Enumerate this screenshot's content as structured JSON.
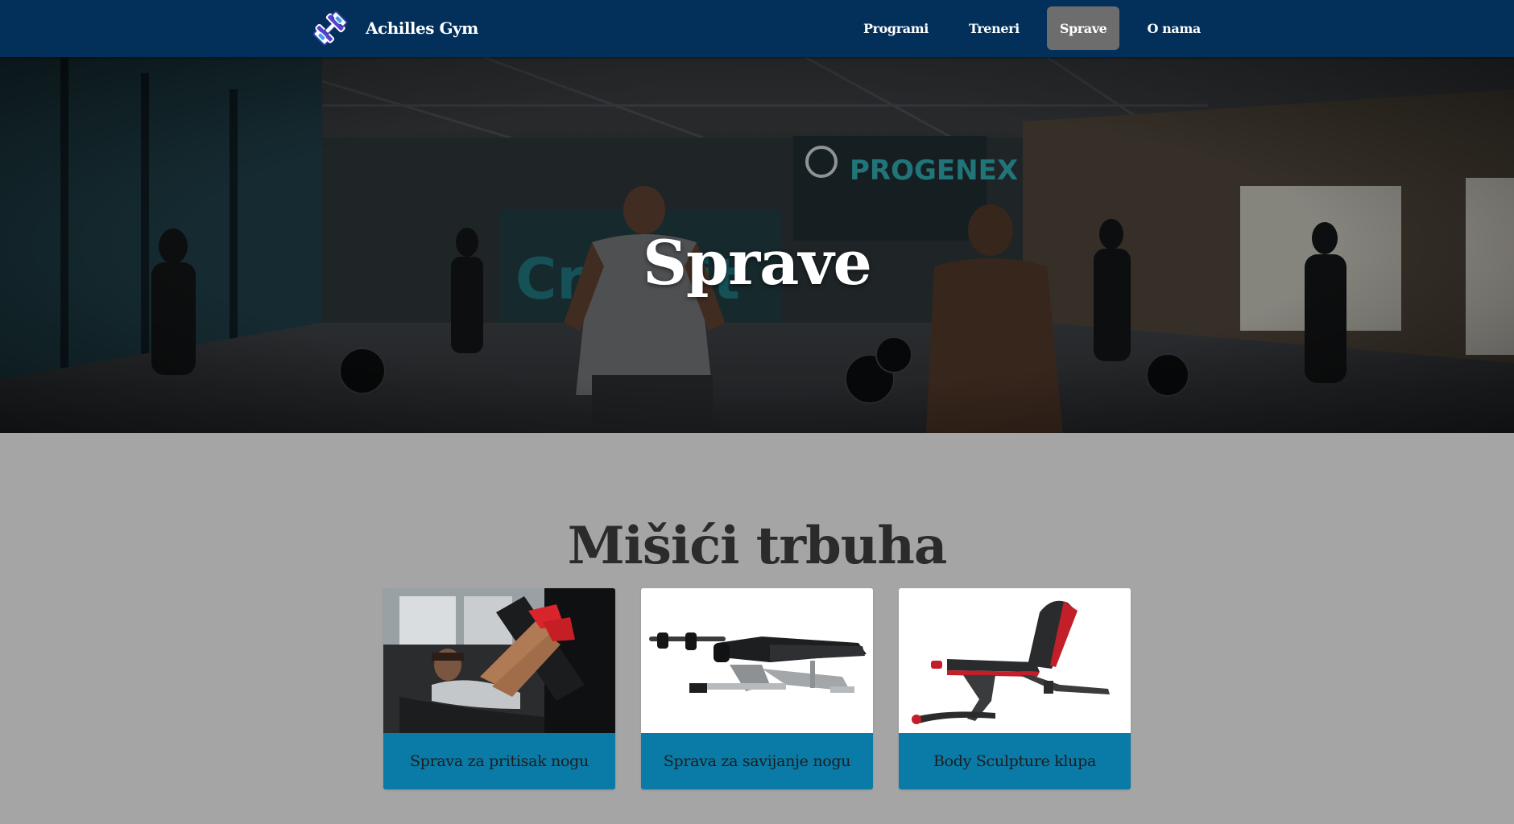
{
  "brand": {
    "name": "Achilles Gym",
    "logo_icon": "dumbbell-logo-icon",
    "colors": {
      "navbar": "#03305a",
      "active_tab": "#6d6d6d",
      "card_label": "#0a7aa6",
      "page_background": "#a5a5a5"
    }
  },
  "nav": {
    "items": [
      {
        "label": "Programi",
        "active": false
      },
      {
        "label": "Treneri",
        "active": false
      },
      {
        "label": "Sprave",
        "active": true
      },
      {
        "label": "O nama",
        "active": false
      }
    ]
  },
  "hero": {
    "title": "Sprave"
  },
  "section": {
    "title": "Mišići trbuha",
    "cards": [
      {
        "label": "Sprava za pritisak nogu",
        "image": "leg-press-photo"
      },
      {
        "label": "Sprava za savijanje nogu",
        "image": "leg-curl-machine-photo"
      },
      {
        "label": "Body Sculpture klupa",
        "image": "adjustable-bench-photo"
      }
    ]
  }
}
